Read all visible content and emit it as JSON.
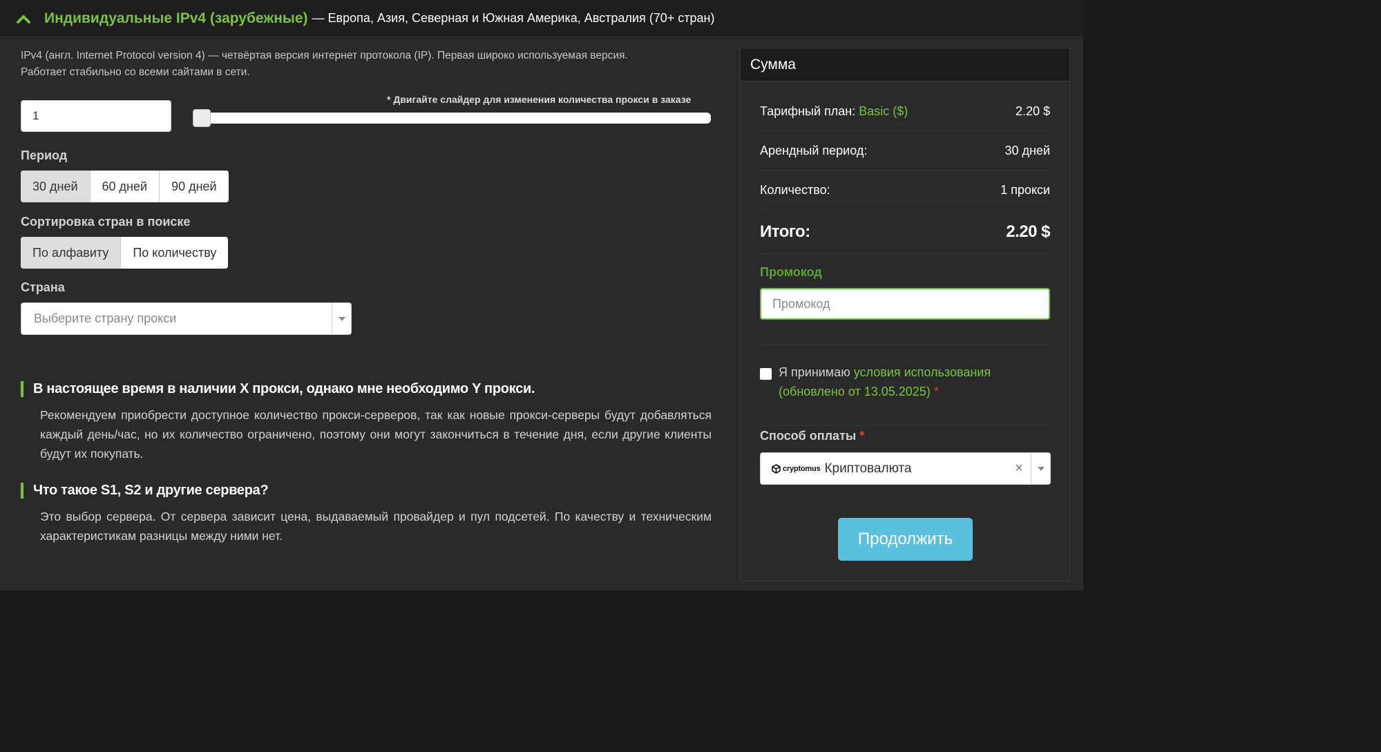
{
  "header": {
    "title": "Индивидуальные IPv4 (зарубежные)",
    "subtitle": "— Европа, Азия, Северная и Южная Америка, Австралия (70+ стран)"
  },
  "description": {
    "line1": "IPv4 (англ. Internet Protocol version 4) — четвёртая версия интернет протокола (IP). Первая широко используемая версия.",
    "line2": "Работает стабильно со всеми сайтами в сети."
  },
  "quantity": {
    "value": "1",
    "slider_hint": "* Двигайте слайдер для изменения количества прокси в заказе",
    "slider_fraction": 0
  },
  "period": {
    "label": "Период",
    "options": [
      "30 дней",
      "60 дней",
      "90 дней"
    ],
    "selected": "30 дней"
  },
  "sorting": {
    "label": "Сортировка стран в поиске",
    "options": [
      "По алфавиту",
      "По количеству"
    ],
    "selected": "По алфавиту"
  },
  "country": {
    "label": "Страна",
    "placeholder": "Выберите страну прокси"
  },
  "faq": [
    {
      "question": "В настоящее время в наличии X прокси, однако мне необходимо Y прокси.",
      "answer": "Рекомендуем приобрести доступное количество прокси-серверов, так как новые прокси-серверы будут добавляться каждый день/час, но их количество ограничено, поэтому они могут закончиться в течение дня, если другие клиенты будут их покупать."
    },
    {
      "question": "Что такое S1, S2 и другие сервера?",
      "answer": "Это выбор сервера. От сервера зависит цена, выдаваемый провайдер и пул подсетей. По качеству и техническим характеристикам разницы между ними нет."
    }
  ],
  "summary": {
    "title": "Сумма",
    "plan_label": "Тарифный план:",
    "plan_name": "Basic ($)",
    "plan_price": "2.20 $",
    "period_label": "Арендный период:",
    "period_value": "30 дней",
    "qty_label": "Количество:",
    "qty_value": "1 прокси",
    "total_label": "Итого:",
    "total_value": "2.20 $",
    "promo_label": "Промокод",
    "promo_placeholder": "Промокод",
    "terms_prefix": "Я принимаю",
    "terms_link": "условия использования (обновлено от 13.05.2025)",
    "required_mark": "*",
    "payment_label": "Способ оплаты",
    "payment_logo_text": "cryptomus",
    "payment_value": "Криптовалюта",
    "clear_symbol": "×",
    "continue_label": "Продолжить"
  },
  "colors": {
    "accent_green": "#7cc242",
    "button_blue": "#5bc0de",
    "required_red": "#e2423a"
  },
  "icons": {
    "header": "chevron-up-icon",
    "select": "caret-down-icon",
    "payment": "cryptomus-logo"
  }
}
